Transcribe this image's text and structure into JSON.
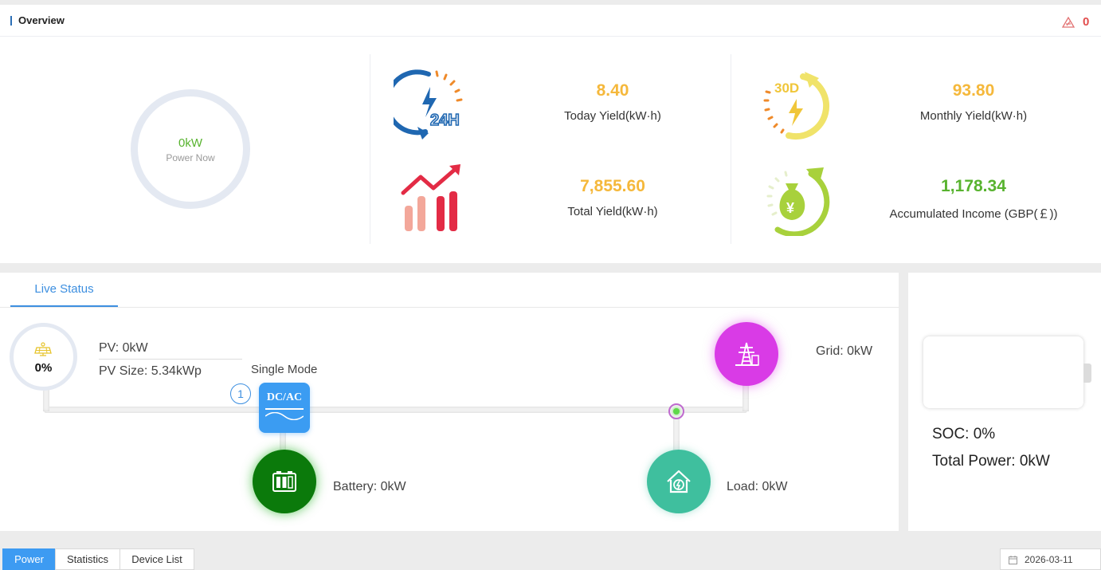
{
  "overview": {
    "title": "Overview",
    "alarm_count": "0",
    "power_now_value": "0kW",
    "power_now_label": "Power Now",
    "stats": [
      {
        "value": "8.40",
        "label": "Today Yield(kW·h)",
        "color": "#f5b83b",
        "icon": "24h-yield-icon"
      },
      {
        "value": "93.80",
        "label": "Monthly Yield(kW·h)",
        "color": "#f5b83b",
        "icon": "30d-yield-icon"
      },
      {
        "value": "7,855.60",
        "label": "Total Yield(kW·h)",
        "color": "#f5b83b",
        "icon": "total-yield-chart-icon"
      },
      {
        "value": "1,178.34",
        "label": "Accumulated Income (GBP(￡))",
        "color": "#58b32f",
        "icon": "income-money-bag-icon"
      }
    ],
    "icon_text": {
      "h24": "24H",
      "d30": "30D",
      "yen": "¥"
    }
  },
  "live": {
    "tab_label": "Live Status",
    "pv_percent": "0%",
    "pv_power": "PV:  0kW",
    "pv_size": "PV Size:  5.34kWp",
    "mode": "Single Mode",
    "inverter_index": "1",
    "inverter_label": "DC/AC",
    "grid": "Grid:  0kW",
    "battery": "Battery:  0kW",
    "load": "Load:  0kW",
    "colors": {
      "grid": "#d93be6",
      "battery": "#0b7a0b",
      "load": "#3fbf9e",
      "inverter": "#3b9cf2"
    }
  },
  "battery_panel": {
    "soc": "SOC:  0%",
    "total_power": "Total Power:  0kW"
  },
  "bottom": {
    "tabs": [
      "Power",
      "Statistics",
      "Device List"
    ],
    "active_tab": "Power",
    "date": "2026-03-11"
  },
  "accent_color": "#3d8fe0"
}
